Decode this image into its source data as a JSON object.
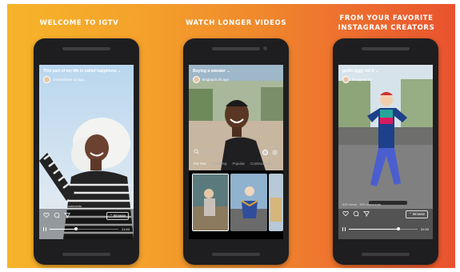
{
  "panels": [
    {
      "caption": "WELCOME TO IGTV",
      "video_title": "This part of my life is called happiness ⌄",
      "username": "mosesshere 1d ago",
      "stats": "92K views · 520 comments",
      "browse_label": "⌃ Browse",
      "time": "21:53",
      "progress": 0.38
    },
    {
      "caption": "WATCH LONGER VIDEOS",
      "video_title": "Buying a sweater ⌄",
      "username": "kingbach 2h ago",
      "search_placeholder": "Search",
      "tabs": [
        "For You",
        "Following",
        "Popular",
        "Continue Wa"
      ]
    },
    {
      "caption_line1": "FROM YOUR FAVORITE",
      "caption_line2": "INSTAGRAM CREATORS",
      "video_title": "gettin jiggy wit it ⌄",
      "username": "flexaprod 1d",
      "stats": "92K views · 920 comments",
      "browse_label": "⌃ Browse",
      "time": "31:53",
      "progress": 0.72
    }
  ],
  "colors": {
    "gradient_start": "#f6b42a",
    "gradient_end": "#e9532f",
    "phone_body": "#1e1e20"
  }
}
